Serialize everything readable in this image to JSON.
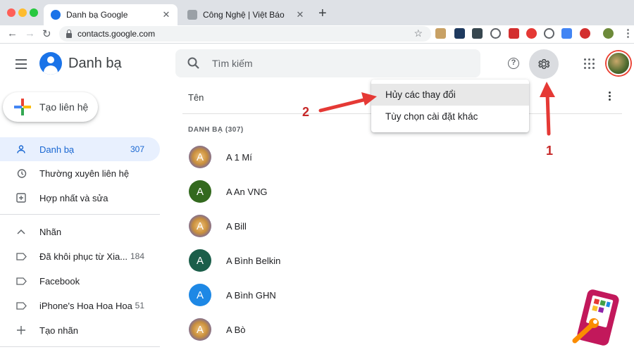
{
  "browser": {
    "tabs": [
      {
        "title": "Danh bạ Google",
        "active": true
      },
      {
        "title": "Công Nghệ | Việt Báo",
        "active": false
      }
    ],
    "new_tab": "+",
    "close_glyph": "✕",
    "url": "contacts.google.com"
  },
  "app": {
    "title": "Danh bạ",
    "search_placeholder": "Tìm kiếm",
    "help_glyph": "?"
  },
  "sidebar": {
    "create_label": "Tạo liên hệ",
    "items": [
      {
        "label": "Danh bạ",
        "count": "307",
        "icon": "person-icon"
      },
      {
        "label": "Thường xuyên liên hệ",
        "count": "",
        "icon": "history-icon"
      },
      {
        "label": "Hợp nhất và sửa",
        "count": "",
        "icon": "merge-icon"
      }
    ],
    "labels_heading": "Nhãn",
    "labels": [
      {
        "label": "Đã khôi phục từ Xia...",
        "count": "184"
      },
      {
        "label": "Facebook",
        "count": ""
      },
      {
        "label": "iPhone's Hoa Hoa Hoa",
        "count": "51"
      }
    ],
    "create_label_item": "Tạo nhãn"
  },
  "main": {
    "column_header": "Tên",
    "section_title": "DANH BẠ (307)",
    "contacts": [
      {
        "initial": "A",
        "name": "A 1 Mí",
        "color": "#c98f3c",
        "photo": true
      },
      {
        "initial": "A",
        "name": "A An VNG",
        "color": "#33691e",
        "photo": false
      },
      {
        "initial": "A",
        "name": "A Bill",
        "color": "#c98f3c",
        "photo": true
      },
      {
        "initial": "A",
        "name": "A Bình Belkin",
        "color": "#1b5e4a",
        "photo": false
      },
      {
        "initial": "A",
        "name": "A Bình GHN",
        "color": "#1e88e5",
        "photo": false
      },
      {
        "initial": "A",
        "name": "A Bò",
        "color": "#c98f3c",
        "photo": true
      }
    ]
  },
  "settings_menu": {
    "items": [
      "Hủy các thay đổi",
      "Tùy chọn cài đặt khác"
    ]
  },
  "annotations": {
    "step1": "1",
    "step2": "2"
  },
  "colors": {
    "accent": "#1a73e8",
    "annotation_red": "#e53935"
  }
}
